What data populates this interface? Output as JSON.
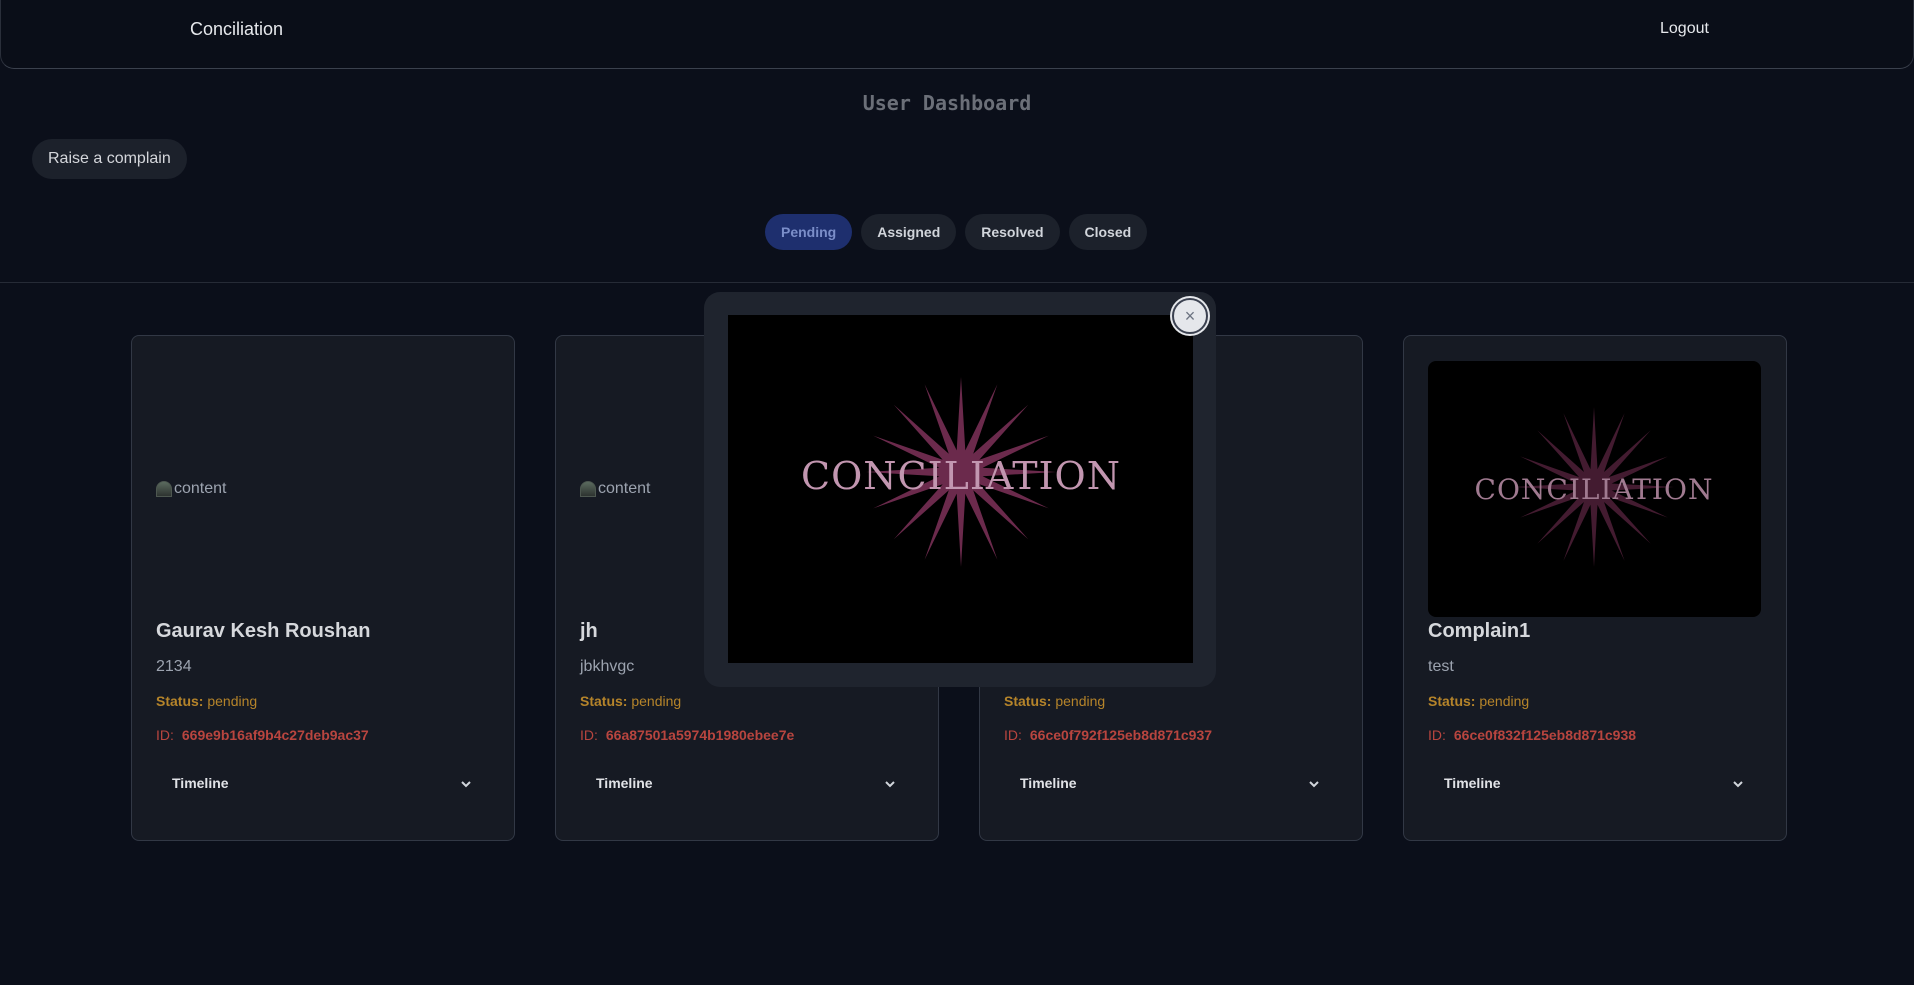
{
  "app": {
    "brand": "Conciliation",
    "logout_label": "Logout"
  },
  "page": {
    "title": "User Dashboard",
    "raise_label": "Raise a complain"
  },
  "tabs": [
    {
      "label": "Pending",
      "active": true
    },
    {
      "label": "Assigned",
      "active": false
    },
    {
      "label": "Resolved",
      "active": false
    },
    {
      "label": "Closed",
      "active": false
    }
  ],
  "labels": {
    "status": "Status:",
    "id": "ID:",
    "timeline": "Timeline",
    "image_alt": "content"
  },
  "logo_text": "CONCILIATION",
  "cards": [
    {
      "title": "Gaurav Kesh Roushan",
      "desc": "2134",
      "status": "pending",
      "id": "669e9b16af9b4c27deb9ac37",
      "image": "broken"
    },
    {
      "title": "jh",
      "desc": "jbkhvgc",
      "status": "pending",
      "id": "66a87501a5974b1980ebee7e",
      "image": "broken"
    },
    {
      "title": "",
      "desc": "",
      "status": "pending",
      "id": "66ce0f792f125eb8d871c937",
      "image": "hidden"
    },
    {
      "title": "Complain1",
      "desc": "test",
      "status": "pending",
      "id": "66ce0f832f125eb8d871c938",
      "image": "logo"
    }
  ],
  "modal": {
    "close_icon": "close-icon",
    "image": "conciliation-logo"
  },
  "colors": {
    "accent_tab": "#1e2f6e",
    "status": "#b5842a",
    "id": "#b8453f",
    "logo_star": "#5a2440",
    "logo_text": "#b98aa6"
  }
}
